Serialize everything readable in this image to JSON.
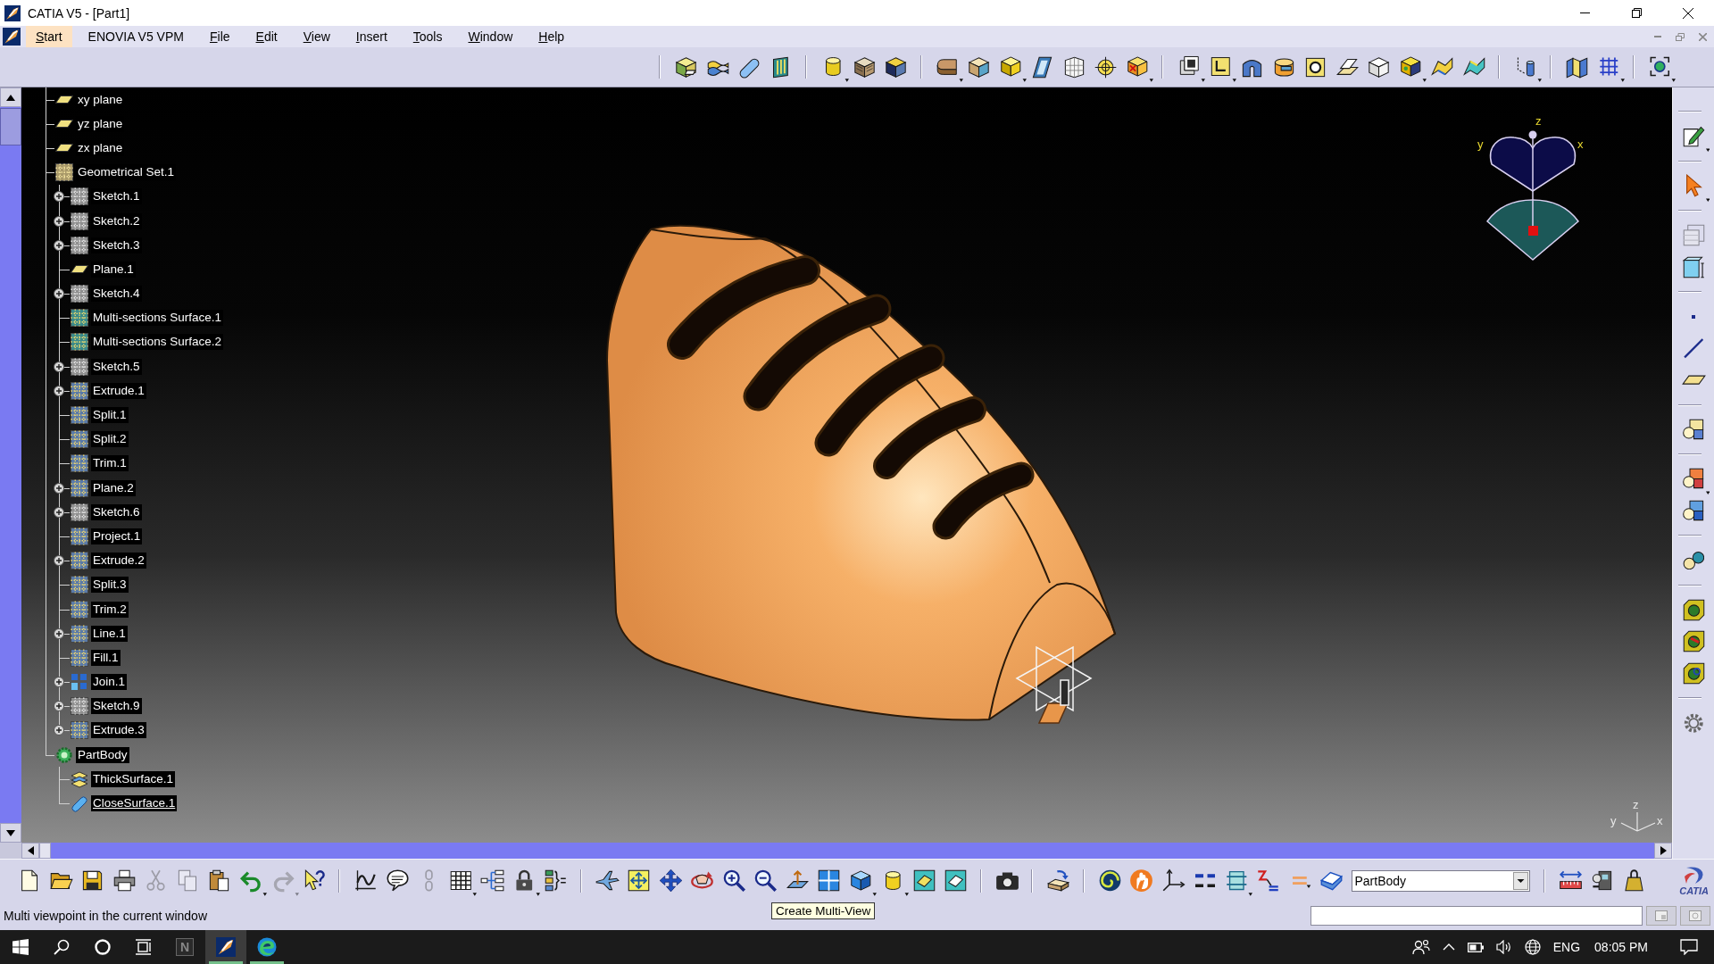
{
  "window": {
    "title": "CATIA V5 - [Part1]"
  },
  "menu": [
    {
      "label": "Start",
      "selected": true,
      "mnemonic": true
    },
    {
      "label": "ENOVIA V5 VPM",
      "selected": false,
      "mnemonic": false
    },
    {
      "label": "File",
      "selected": false,
      "mnemonic": true
    },
    {
      "label": "Edit",
      "selected": false,
      "mnemonic": true
    },
    {
      "label": "View",
      "selected": false,
      "mnemonic": true
    },
    {
      "label": "Insert",
      "selected": false,
      "mnemonic": true
    },
    {
      "label": "Tools",
      "selected": false,
      "mnemonic": true
    },
    {
      "label": "Window",
      "selected": false,
      "mnemonic": true
    },
    {
      "label": "Help",
      "selected": false,
      "mnemonic": true
    }
  ],
  "top_toolbar": [
    {
      "kind": "separator"
    },
    {
      "kind": "partcube"
    },
    {
      "kind": "layers"
    },
    {
      "kind": "capsule"
    },
    {
      "kind": "panel"
    },
    {
      "kind": "separator"
    },
    {
      "kind": "cylinder"
    },
    {
      "kind": "hatchcube"
    },
    {
      "kind": "darkcube"
    },
    {
      "kind": "separator"
    },
    {
      "kind": "roundblock"
    },
    {
      "kind": "beigecube"
    },
    {
      "kind": "yellowcube"
    },
    {
      "kind": "slant"
    },
    {
      "kind": "lattice"
    },
    {
      "kind": "crosshair"
    },
    {
      "kind": "redcube"
    },
    {
      "kind": "separator"
    },
    {
      "kind": "frame"
    },
    {
      "kind": "square"
    },
    {
      "kind": "arch"
    },
    {
      "kind": "cshape"
    },
    {
      "kind": "ring"
    },
    {
      "kind": "planes"
    },
    {
      "kind": "whitecube"
    },
    {
      "kind": "bluecube"
    },
    {
      "kind": "wave"
    },
    {
      "kind": "wave2"
    },
    {
      "kind": "separator"
    },
    {
      "kind": "cylinders"
    },
    {
      "kind": "separator"
    },
    {
      "kind": "panels"
    },
    {
      "kind": "dotgrid"
    },
    {
      "kind": "separator"
    },
    {
      "kind": "target"
    }
  ],
  "tree": [
    {
      "label": "xy plane",
      "kind": "plane",
      "current": false
    },
    {
      "label": "yz plane",
      "kind": "plane",
      "current": false
    },
    {
      "label": "zx plane",
      "kind": "plane",
      "current": false
    },
    {
      "label": "Geometrical Set.1",
      "kind": "set",
      "current": false,
      "children": [
        {
          "label": "Sketch.1",
          "kind": "sketch",
          "expandable": true,
          "current": false
        },
        {
          "label": "Sketch.2",
          "kind": "sketch",
          "expandable": true,
          "current": false
        },
        {
          "label": "Sketch.3",
          "kind": "sketch",
          "expandable": true,
          "current": false
        },
        {
          "label": "Plane.1",
          "kind": "plane",
          "expandable": false,
          "current": false
        },
        {
          "label": "Sketch.4",
          "kind": "sketch",
          "expandable": true,
          "current": false
        },
        {
          "label": "Multi-sections Surface.1",
          "kind": "surface",
          "expandable": false,
          "current": false
        },
        {
          "label": "Multi-sections Surface.2",
          "kind": "surface",
          "expandable": false,
          "current": false
        },
        {
          "label": "Sketch.5",
          "kind": "sketch",
          "expandable": true,
          "current": false
        },
        {
          "label": "Extrude.1",
          "kind": "feature",
          "expandable": true,
          "current": false
        },
        {
          "label": "Split.1",
          "kind": "feature",
          "expandable": false,
          "current": false
        },
        {
          "label": "Split.2",
          "kind": "feature",
          "expandable": false,
          "current": false
        },
        {
          "label": "Trim.1",
          "kind": "feature",
          "expandable": false,
          "current": false
        },
        {
          "label": "Plane.2",
          "kind": "feature",
          "expandable": true,
          "current": false
        },
        {
          "label": "Sketch.6",
          "kind": "sketch",
          "expandable": true,
          "current": false
        },
        {
          "label": "Project.1",
          "kind": "feature",
          "expandable": false,
          "current": false
        },
        {
          "label": "Extrude.2",
          "kind": "feature",
          "expandable": true,
          "current": false
        },
        {
          "label": "Split.3",
          "kind": "feature",
          "expandable": false,
          "current": false
        },
        {
          "label": "Trim.2",
          "kind": "feature",
          "expandable": false,
          "current": false
        },
        {
          "label": "Line.1",
          "kind": "feature",
          "expandable": true,
          "current": false
        },
        {
          "label": "Fill.1",
          "kind": "feature",
          "expandable": false,
          "current": false
        },
        {
          "label": "Join.1",
          "kind": "join",
          "expandable": true,
          "current": false
        },
        {
          "label": "Sketch.9",
          "kind": "sketch",
          "expandable": true,
          "current": false
        },
        {
          "label": "Extrude.3",
          "kind": "feature",
          "expandable": true,
          "current": false
        }
      ]
    },
    {
      "label": "PartBody",
      "kind": "body",
      "current": false,
      "children": [
        {
          "label": "ThickSurface.1",
          "kind": "thick",
          "expandable": false,
          "current": false
        },
        {
          "label": "CloseSurface.1",
          "kind": "close",
          "expandable": false,
          "current": true
        }
      ]
    }
  ],
  "viewer": {
    "compass_labels": [
      "z",
      "y",
      "x"
    ],
    "triad_labels": [
      "z",
      "y",
      "x"
    ]
  },
  "right_toolbar": [
    {
      "kind": "separator"
    },
    {
      "kind": "sketch",
      "disabled": false
    },
    {
      "kind": "separator"
    },
    {
      "kind": "select",
      "disabled": false
    },
    {
      "kind": "separator"
    },
    {
      "kind": "frameview",
      "disabled": true
    },
    {
      "kind": "boxdim",
      "disabled": false
    },
    {
      "kind": "separator"
    },
    {
      "kind": "point",
      "disabled": false
    },
    {
      "kind": "line",
      "disabled": false
    },
    {
      "kind": "plane",
      "disabled": false
    },
    {
      "kind": "separator"
    },
    {
      "kind": "parts",
      "disabled": false
    },
    {
      "kind": "separator"
    },
    {
      "kind": "parts2",
      "disabled": false
    },
    {
      "kind": "parts3",
      "disabled": false
    },
    {
      "kind": "separator"
    },
    {
      "kind": "spheres",
      "disabled": false
    },
    {
      "kind": "separator"
    },
    {
      "kind": "catalog",
      "disabled": false
    },
    {
      "kind": "catalog2",
      "disabled": false
    },
    {
      "kind": "catalog3",
      "disabled": false
    },
    {
      "kind": "separator"
    },
    {
      "kind": "settings",
      "disabled": false
    }
  ],
  "bottom_toolbar": [
    {
      "kind": "new",
      "disabled": false
    },
    {
      "kind": "open",
      "disabled": false
    },
    {
      "kind": "save",
      "disabled": false
    },
    {
      "kind": "print",
      "disabled": false
    },
    {
      "kind": "cut",
      "disabled": true
    },
    {
      "kind": "copy",
      "disabled": true
    },
    {
      "kind": "paste",
      "disabled": false
    },
    {
      "kind": "undo",
      "disabled": false
    },
    {
      "kind": "redo",
      "disabled": true
    },
    {
      "kind": "help",
      "disabled": false
    },
    {
      "kind": "separator"
    },
    {
      "kind": "formula",
      "disabled": false
    },
    {
      "kind": "comment",
      "disabled": false
    },
    {
      "kind": "link",
      "disabled": true
    },
    {
      "kind": "table",
      "disabled": false
    },
    {
      "kind": "hierarchy",
      "disabled": false
    },
    {
      "kind": "lock",
      "disabled": false
    },
    {
      "kind": "list",
      "disabled": false
    },
    {
      "kind": "separator"
    },
    {
      "kind": "fly",
      "disabled": false
    },
    {
      "kind": "fit",
      "disabled": false
    },
    {
      "kind": "pan",
      "disabled": false
    },
    {
      "kind": "rotate",
      "disabled": false
    },
    {
      "kind": "zoomin",
      "disabled": false
    },
    {
      "kind": "zoomout",
      "disabled": false
    },
    {
      "kind": "normal",
      "disabled": false
    },
    {
      "kind": "multiview",
      "disabled": false
    },
    {
      "kind": "isoview",
      "disabled": false
    },
    {
      "kind": "shading",
      "disabled": false
    },
    {
      "kind": "shade1",
      "disabled": false
    },
    {
      "kind": "shade2",
      "disabled": false
    },
    {
      "kind": "separator"
    },
    {
      "kind": "camera",
      "disabled": false
    },
    {
      "kind": "separator"
    },
    {
      "kind": "swap",
      "disabled": false
    },
    {
      "kind": "separator"
    },
    {
      "kind": "spiral",
      "disabled": false
    },
    {
      "kind": "hand",
      "disabled": false
    },
    {
      "kind": "axes",
      "disabled": false
    },
    {
      "kind": "numbers",
      "disabled": false
    },
    {
      "kind": "section",
      "disabled": false
    },
    {
      "kind": "snap",
      "disabled": false
    },
    {
      "kind": "equals",
      "disabled": false
    },
    {
      "kind": "book",
      "disabled": false
    },
    {
      "kind": "combo",
      "value": "PartBody"
    },
    {
      "kind": "separator"
    },
    {
      "kind": "ruler",
      "disabled": false
    },
    {
      "kind": "measure",
      "disabled": false
    },
    {
      "kind": "weight",
      "disabled": false
    }
  ],
  "logo": "CATIA",
  "status_bar": {
    "message": "Multi viewpoint in the current window"
  },
  "tooltip": "Create Multi-View",
  "taskbar": {
    "apps": [
      {
        "kind": "notes",
        "glyph": "N",
        "active": false,
        "running": false
      },
      {
        "kind": "catia",
        "active": true,
        "running": true
      },
      {
        "kind": "browser",
        "active": false,
        "running": true
      }
    ],
    "language": "ENG",
    "time": "08:05 PM"
  }
}
